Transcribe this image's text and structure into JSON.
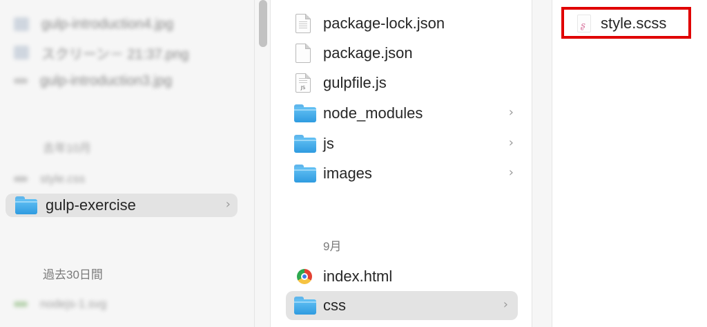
{
  "sidebar": {
    "blurred_rows": [
      {
        "text": "gulp-introduction4.jpg"
      },
      {
        "text": "スクリーン－ 21:37.png"
      },
      {
        "text": "gulp-introduction3.jpg"
      }
    ],
    "blurred_section": "去年10月",
    "blurred_file": "style.css",
    "selected_folder": {
      "label": "gulp-exercise",
      "icon": "folder-icon"
    },
    "section_label": "過去30日間",
    "blurred_bottom": "nodejs-1.svg"
  },
  "middle": {
    "items": [
      {
        "label": "package-lock.json",
        "icon": "document-icon"
      },
      {
        "label": "package.json",
        "icon": "document-icon"
      },
      {
        "label": "gulpfile.js",
        "icon": "js-file-icon"
      },
      {
        "label": "node_modules",
        "icon": "folder-icon",
        "has_children": true
      },
      {
        "label": "js",
        "icon": "folder-icon",
        "has_children": true
      },
      {
        "label": "images",
        "icon": "folder-icon",
        "has_children": true
      }
    ],
    "section_label": "9月",
    "index_file": {
      "label": "index.html",
      "icon": "chrome-icon"
    },
    "selected_folder": {
      "label": "css",
      "icon": "folder-icon",
      "has_children": true
    }
  },
  "right": {
    "file": {
      "label": "style.scss",
      "icon": "sass-file-icon"
    },
    "highlight_color": "#e00000"
  },
  "chevron": "›"
}
